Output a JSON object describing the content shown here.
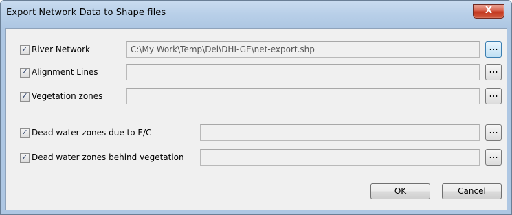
{
  "window": {
    "title": "Export Network Data to Shape files",
    "close_symbol": "X"
  },
  "rows": [
    {
      "label": "River Network",
      "checked": true,
      "path": "C:\\My Work\\Temp\\Del\\DHI-GE\\net-export.shp",
      "browse_label": "..."
    },
    {
      "label": "Alignment Lines",
      "checked": true,
      "path": "",
      "browse_label": "..."
    },
    {
      "label": "Vegetation zones",
      "checked": true,
      "path": "",
      "browse_label": "..."
    },
    {
      "label": "Dead water zones due to E/C",
      "checked": true,
      "path": "",
      "browse_label": "..."
    },
    {
      "label": "Dead water zones behind vegetation",
      "checked": true,
      "path": "",
      "browse_label": "..."
    }
  ],
  "check_mark": "✓",
  "buttons": {
    "ok": "OK",
    "cancel": "Cancel"
  }
}
